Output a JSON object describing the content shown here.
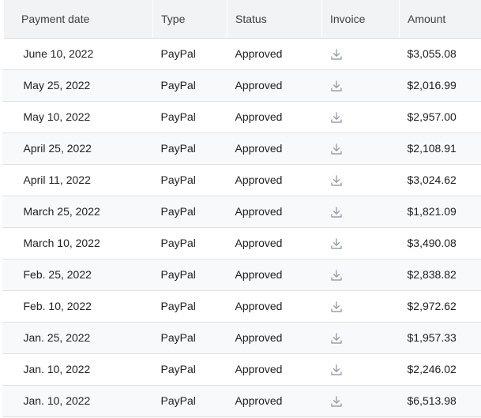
{
  "table": {
    "headers": {
      "payment_date": "Payment date",
      "type": "Type",
      "status": "Status",
      "invoice": "Invoice",
      "amount": "Amount"
    },
    "rows": [
      {
        "date": "June 10, 2022",
        "type": "PayPal",
        "status": "Approved",
        "invoice_icon": "download-icon",
        "amount": "$3,055.08"
      },
      {
        "date": "May 25, 2022",
        "type": "PayPal",
        "status": "Approved",
        "invoice_icon": "download-icon",
        "amount": "$2,016.99"
      },
      {
        "date": "May 10, 2022",
        "type": "PayPal",
        "status": "Approved",
        "invoice_icon": "download-icon",
        "amount": "$2,957.00"
      },
      {
        "date": "April 25, 2022",
        "type": "PayPal",
        "status": "Approved",
        "invoice_icon": "download-icon",
        "amount": "$2,108.91"
      },
      {
        "date": "April 11, 2022",
        "type": "PayPal",
        "status": "Approved",
        "invoice_icon": "download-icon",
        "amount": "$3,024.62"
      },
      {
        "date": "March 25, 2022",
        "type": "PayPal",
        "status": "Approved",
        "invoice_icon": "download-icon",
        "amount": "$1,821.09"
      },
      {
        "date": "March 10, 2022",
        "type": "PayPal",
        "status": "Approved",
        "invoice_icon": "download-icon",
        "amount": "$3,490.08"
      },
      {
        "date": "Feb. 25, 2022",
        "type": "PayPal",
        "status": "Approved",
        "invoice_icon": "download-icon",
        "amount": "$2,838.82"
      },
      {
        "date": "Feb. 10, 2022",
        "type": "PayPal",
        "status": "Approved",
        "invoice_icon": "download-icon",
        "amount": "$2,972.62"
      },
      {
        "date": "Jan. 25, 2022",
        "type": "PayPal",
        "status": "Approved",
        "invoice_icon": "download-icon",
        "amount": "$1,957.33"
      },
      {
        "date": "Jan. 10, 2022",
        "type": "PayPal",
        "status": "Approved",
        "invoice_icon": "download-icon",
        "amount": "$2,246.02"
      },
      {
        "date": "Jan. 10, 2022",
        "type": "PayPal",
        "status": "Approved",
        "invoice_icon": "download-icon",
        "amount": "$6,513.98"
      }
    ]
  },
  "colors": {
    "header_bg": "#f1f3f4",
    "row_alt_bg": "#f8f9fa",
    "icon": "#9aa0a6",
    "text": "#202124"
  }
}
